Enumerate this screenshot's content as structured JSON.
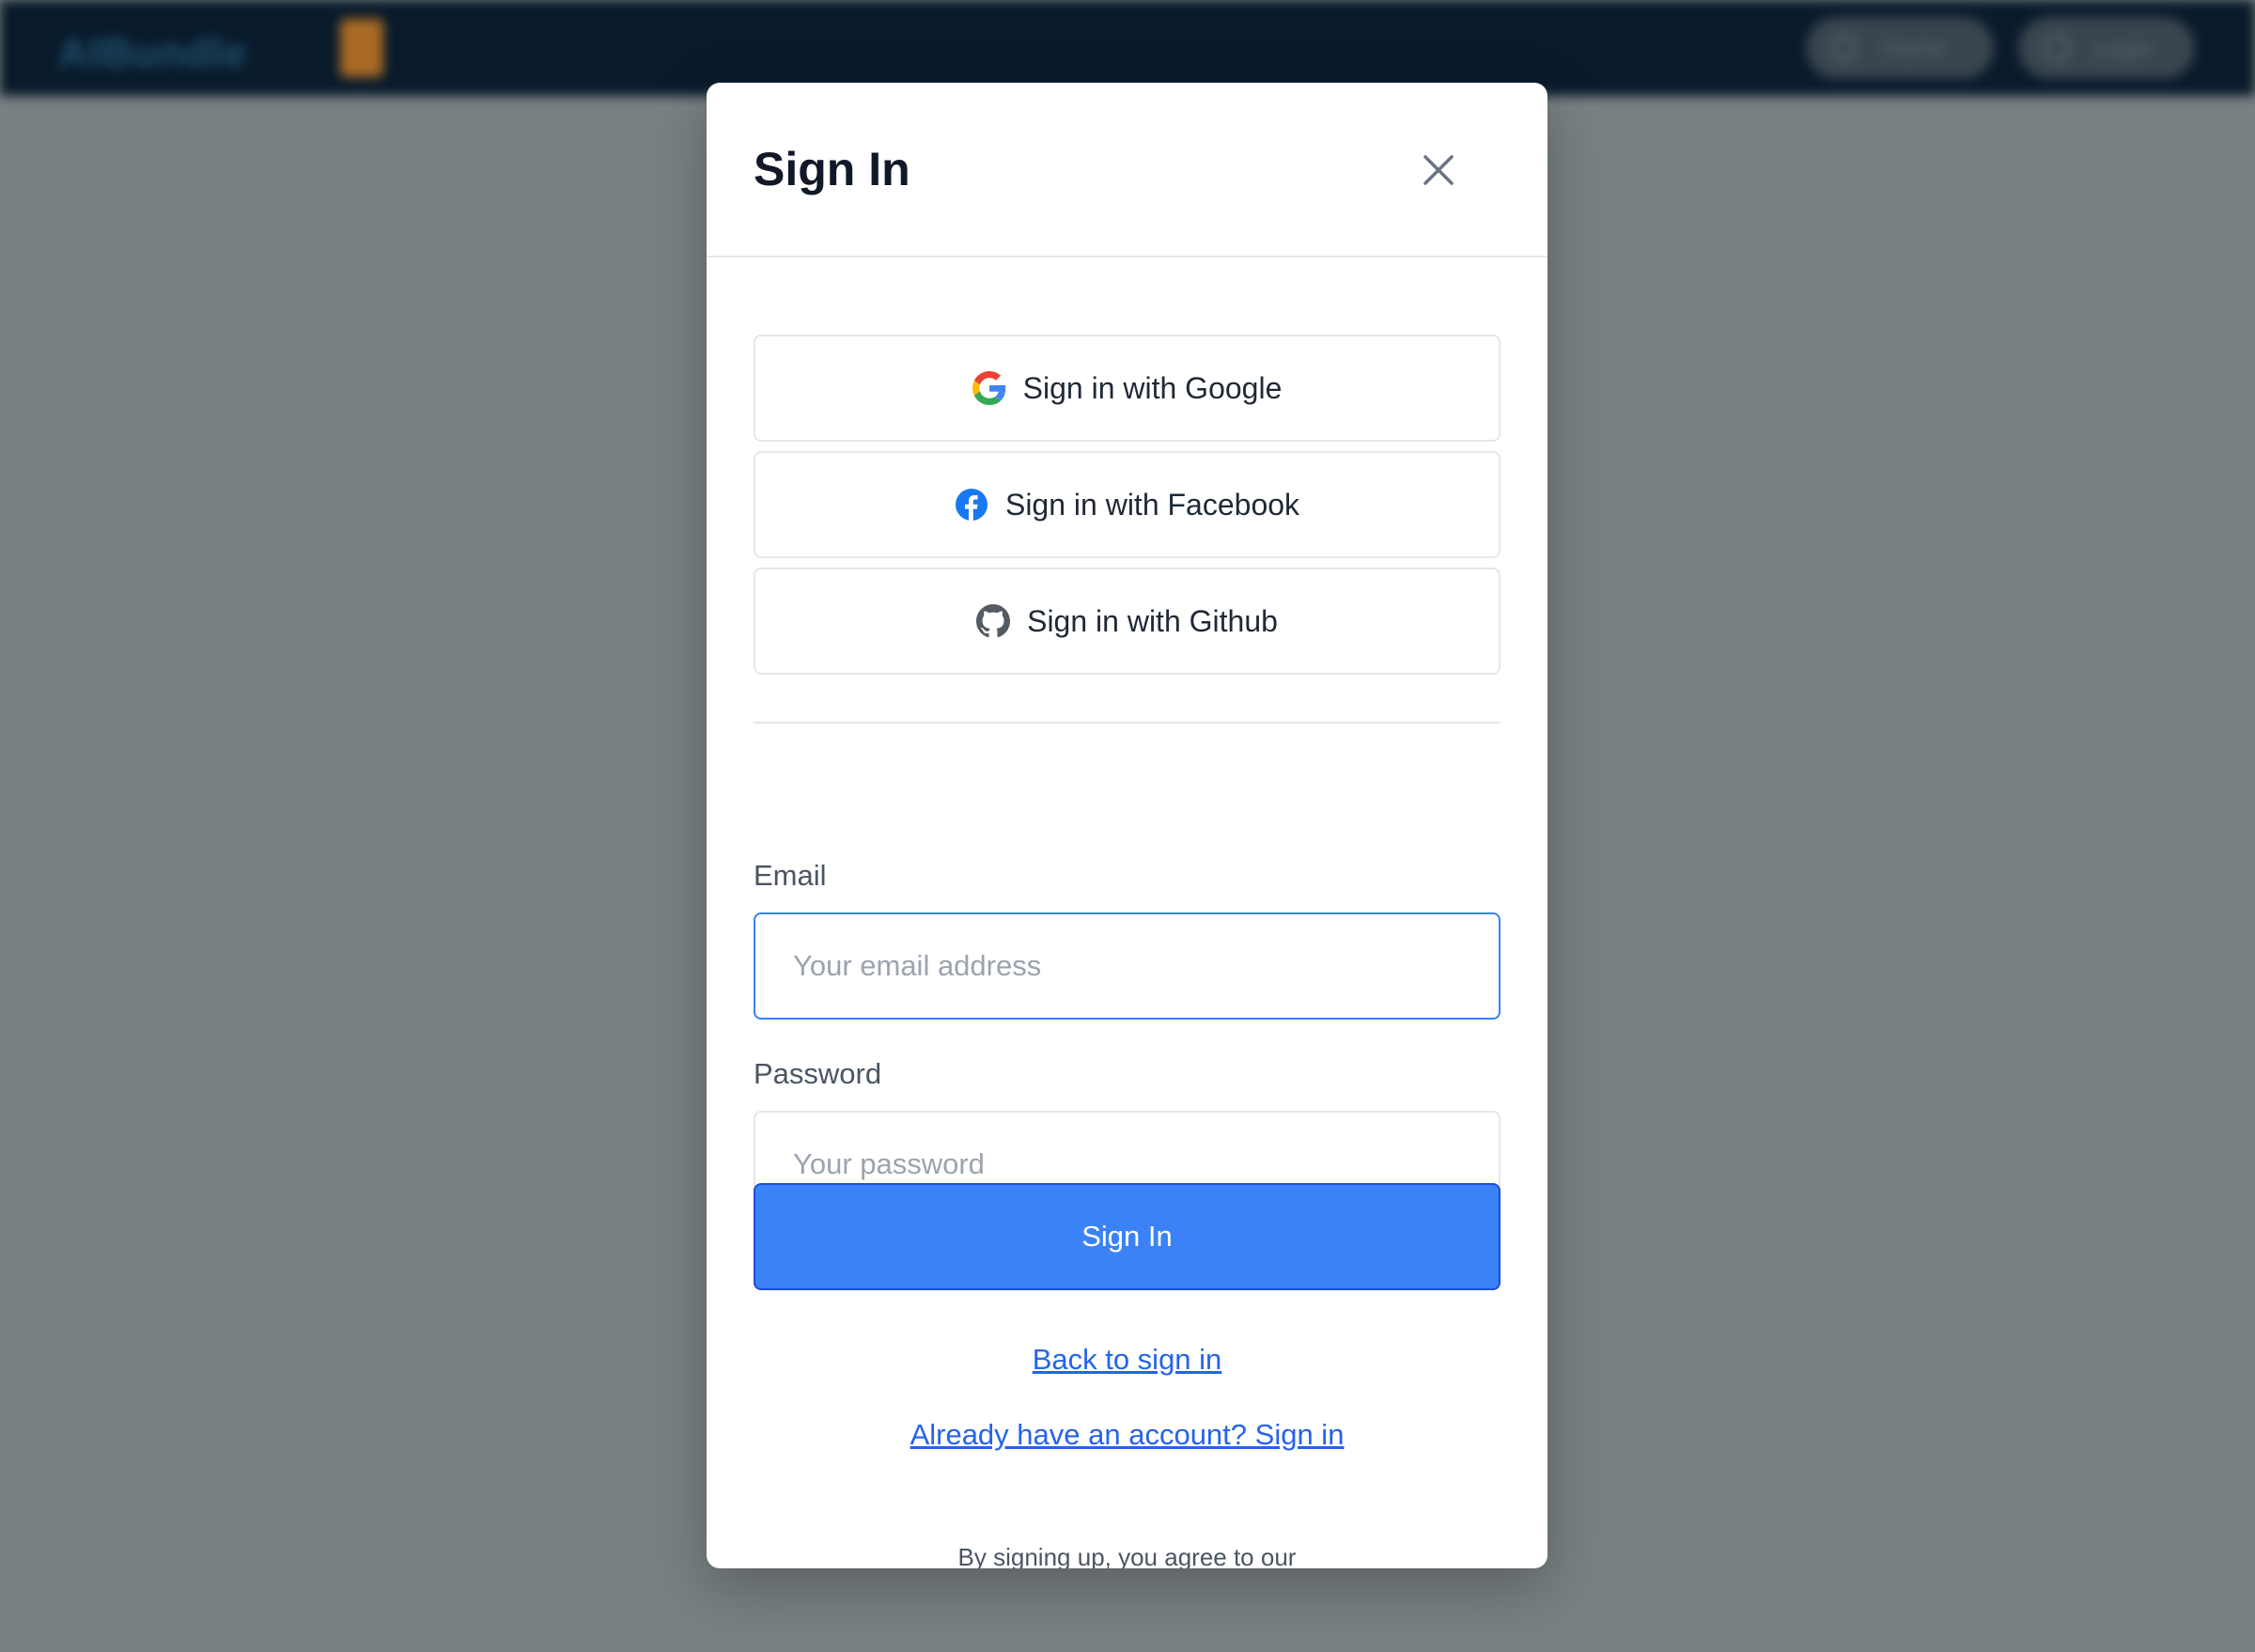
{
  "app": {
    "logo_text": "AIBundle",
    "nav": [
      {
        "label": "Home",
        "icon": "home-icon"
      },
      {
        "label": "Login",
        "icon": "login-icon"
      }
    ]
  },
  "modal": {
    "title": "Sign In",
    "close_icon": "close-icon",
    "social": [
      {
        "label": "Sign in with Google",
        "icon": "google-icon"
      },
      {
        "label": "Sign in with Facebook",
        "icon": "facebook-icon"
      },
      {
        "label": "Sign in with Github",
        "icon": "github-icon"
      }
    ],
    "email": {
      "label": "Email",
      "placeholder": "Your email address",
      "value": ""
    },
    "password": {
      "label": "Password",
      "placeholder": "Your password",
      "value": ""
    },
    "submit_label": "Sign In",
    "links": {
      "back": "Back to sign in",
      "already": "Already have an account? Sign in"
    },
    "footnote": "By signing up, you agree to our"
  },
  "colors": {
    "primary": "#3b82f6",
    "link": "#2563eb",
    "topbar": "#001224",
    "backdrop": "#7b8182"
  }
}
